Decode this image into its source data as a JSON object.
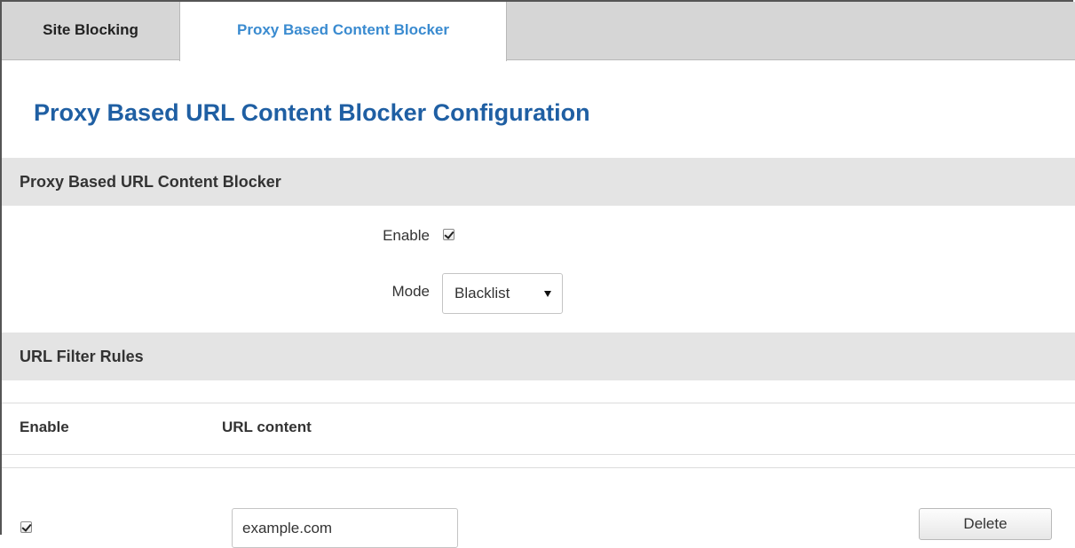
{
  "tabs": {
    "site_blocking": "Site Blocking",
    "proxy_blocker": "Proxy Based Content Blocker"
  },
  "page": {
    "title": "Proxy Based URL Content Blocker Configuration"
  },
  "section1": {
    "title": "Proxy Based URL Content Blocker",
    "enable_label": "Enable",
    "enable_checked": true,
    "mode_label": "Mode",
    "mode_value": "Blacklist"
  },
  "section2": {
    "title": "URL Filter Rules",
    "columns": [
      "Enable",
      "URL content"
    ],
    "rows": [
      {
        "enabled": true,
        "url": "example.com",
        "delete_label": "Delete"
      }
    ]
  },
  "colors": {
    "title_blue": "#1f5fa3",
    "active_tab_blue": "#3a8bd0",
    "section_bg": "#e4e4e4",
    "tabbar_bg": "#d6d6d6"
  }
}
